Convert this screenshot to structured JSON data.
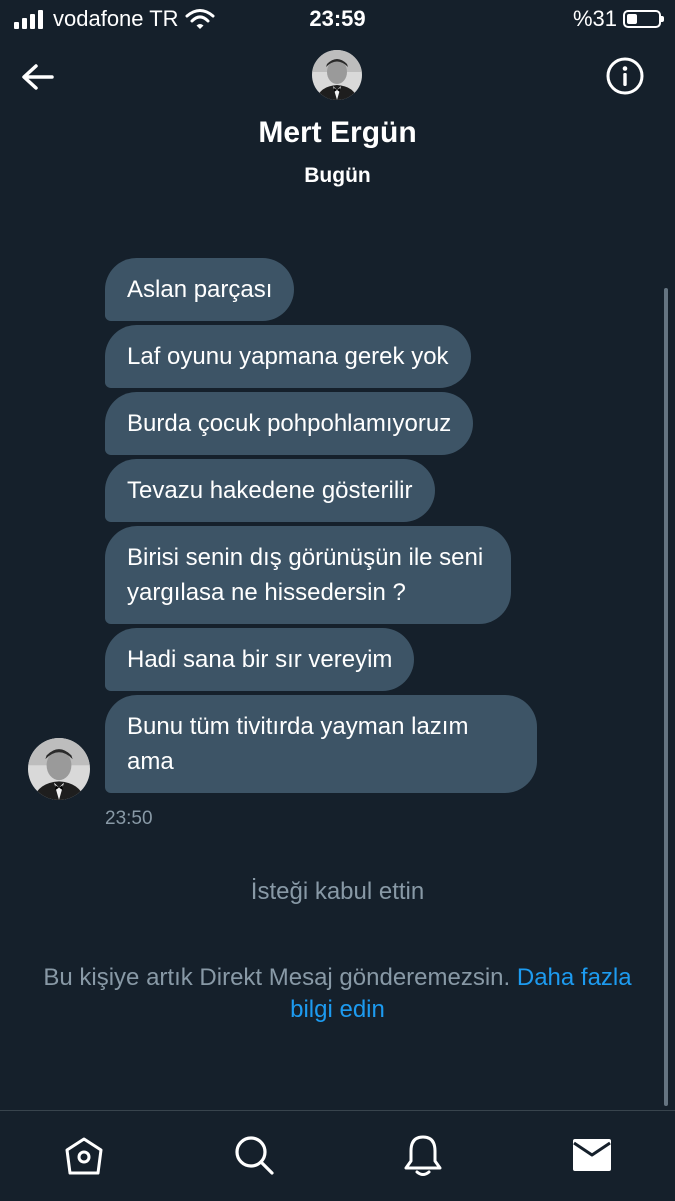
{
  "status_bar": {
    "carrier": "vodafone TR",
    "time": "23:59",
    "battery_percent": "%31",
    "battery_level": 0.31,
    "icons": [
      "signal-icon",
      "wifi-icon",
      "battery-icon"
    ]
  },
  "header": {
    "name": "Mert Ergün",
    "day": "Bugün",
    "icons": [
      "back-arrow-icon",
      "info-icon",
      "avatar"
    ]
  },
  "messages": [
    {
      "text": "Aslan parçası"
    },
    {
      "text": "Laf oyunu yapmana gerek yok"
    },
    {
      "text": "Burda çocuk pohpohlamıyoruz"
    },
    {
      "text": "Tevazu hakedene gösterilir"
    },
    {
      "text": "Birisi senin dış görünüşün ile seni yargılasa ne hissedersin ?"
    },
    {
      "text": "Hadi sana bir sır vereyim"
    },
    {
      "text": "Bunu tüm tivitırda yayman lazım ama"
    }
  ],
  "message_time": "23:50",
  "request_note": "İsteği kabul ettin",
  "dm_note": {
    "text": "Bu kişiye artık Direkt Mesaj gönderemezsin. ",
    "link": "Daha fazla bilgi edin"
  },
  "tabbar": {
    "icons": [
      "home-icon",
      "search-icon",
      "notifications-icon",
      "messages-icon"
    ]
  },
  "colors": {
    "background": "#15202b",
    "bubble": "#3d5466",
    "muted_text": "#8899a6",
    "link": "#1d9bf0"
  }
}
